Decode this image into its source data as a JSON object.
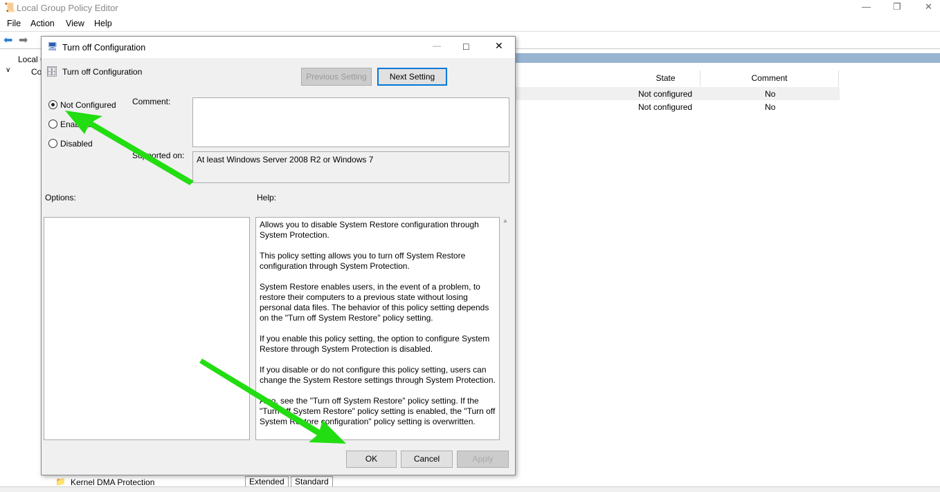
{
  "app": {
    "title": "Local Group Policy Editor",
    "menu": [
      "File",
      "Action",
      "View",
      "Help"
    ]
  },
  "tree": {
    "root": "Local C",
    "computer": "Co",
    "bottom_item": "Kernel DMA Protection"
  },
  "tabs": [
    "Extended",
    "Standard"
  ],
  "list": {
    "columns": [
      "State",
      "Comment"
    ],
    "rows": [
      {
        "state": "Not configured",
        "comment": "No"
      },
      {
        "state": "Not configured",
        "comment": "No"
      }
    ]
  },
  "dialog": {
    "title": "Turn off Configuration",
    "setting_name": "Turn off Configuration",
    "prev_label": "Previous Setting",
    "next_label": "Next Setting",
    "radios": [
      {
        "label": "Not Configured",
        "checked": true
      },
      {
        "label": "Enabled",
        "checked": false
      },
      {
        "label": "Disabled",
        "checked": false
      }
    ],
    "comment_label": "Comment:",
    "supported_label": "Supported on:",
    "supported_value": "At least Windows Server 2008 R2 or Windows 7",
    "options_label": "Options:",
    "help_label": "Help:",
    "help": [
      "Allows you to disable System Restore configuration through System Protection.",
      "This policy setting allows you to turn off System Restore configuration through System Protection.",
      "System Restore enables users, in the event of a problem, to restore their computers to a previous state without losing personal data files. The behavior of this policy setting depends on the \"Turn off System Restore\" policy setting.",
      "If you enable this policy setting, the option to configure System Restore through System Protection is disabled.",
      "If you disable or do not configure this policy setting, users can change the System Restore settings through System Protection.",
      "Also, see the \"Turn off System Restore\" policy setting. If the \"Turn off System Restore\" policy setting is enabled, the \"Turn off System Restore configuration\" policy setting is overwritten."
    ],
    "ok": "OK",
    "cancel": "Cancel",
    "apply": "Apply"
  },
  "colors": {
    "arrow": "#22dd11",
    "header_bar": "#99b4d1"
  }
}
